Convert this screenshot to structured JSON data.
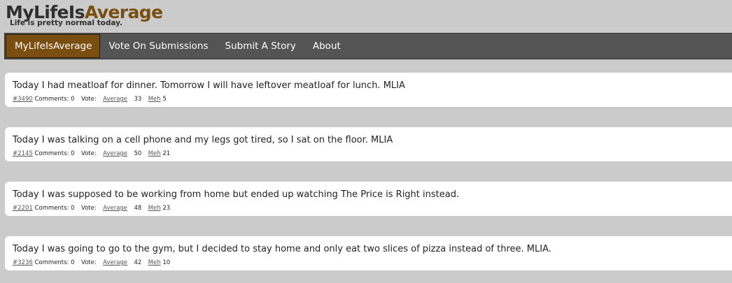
{
  "site": {
    "title_part1": "MyLifeIs",
    "title_part2": "Average",
    "tagline": "Life is pretty normal today."
  },
  "nav": [
    {
      "label": "MyLifeIsAverage",
      "active": true
    },
    {
      "label": "Vote On Submissions",
      "active": false
    },
    {
      "label": "Submit A Story",
      "active": false
    },
    {
      "label": "About",
      "active": false
    }
  ],
  "stories": [
    {
      "text": "Today I had meatloaf for dinner. Tomorrow I will have leftover meatloaf for lunch. MLIA",
      "id": "#3490",
      "comments": "Comments: 0",
      "vote_label": "Vote:",
      "average_label": "Average",
      "average_count": "33",
      "meh_label": "Meh",
      "meh_count": "5"
    },
    {
      "text": "Today I was talking on a cell phone and my legs got tired, so I sat on the floor. MLIA",
      "id": "#2145",
      "comments": "Comments: 0",
      "vote_label": "Vote:",
      "average_label": "Average",
      "average_count": "50",
      "meh_label": "Meh",
      "meh_count": "21"
    },
    {
      "text": "Today I was supposed to be working from home but ended up watching The Price is Right instead.",
      "id": "#2201",
      "comments": "Comments: 0",
      "vote_label": "Vote:",
      "average_label": "Average",
      "average_count": "48",
      "meh_label": "Meh",
      "meh_count": "23"
    },
    {
      "text": "Today I was going to go to the gym, but I decided to stay home and only eat two slices of pizza instead of three. MLIA.",
      "id": "#3236",
      "comments": "Comments: 0",
      "vote_label": "Vote:",
      "average_label": "Average",
      "average_count": "42",
      "meh_label": "Meh",
      "meh_count": "10"
    }
  ],
  "colors": {
    "background": "#cbcbcb",
    "nav_bar": "#545454",
    "brand_brown": "#7a4d10",
    "card": "#ffffff"
  }
}
